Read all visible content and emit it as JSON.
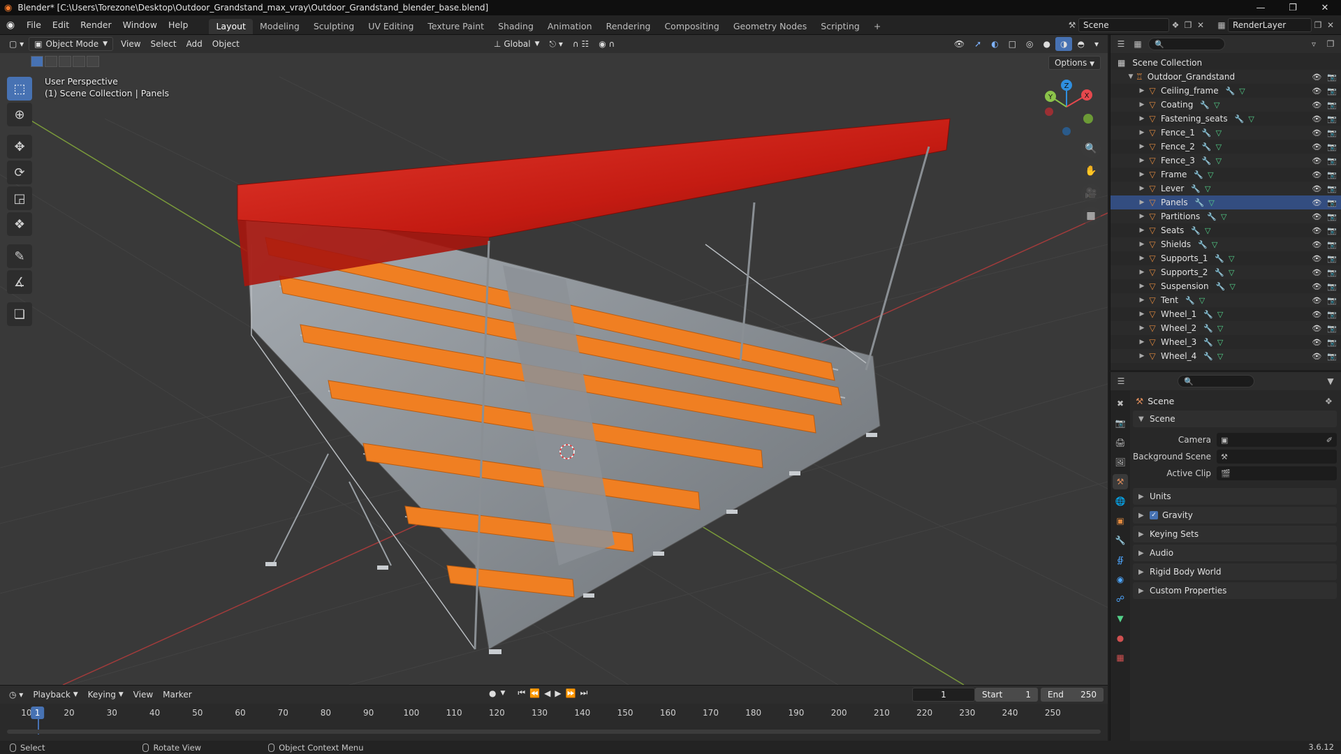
{
  "window": {
    "title": "Blender* [C:\\Users\\Torezone\\Desktop\\Outdoor_Grandstand_max_vray\\Outdoor_Grandstand_blender_base.blend]",
    "minimize": "—",
    "maximize": "❐",
    "close": "✕"
  },
  "menu": [
    "File",
    "Edit",
    "Render",
    "Window",
    "Help"
  ],
  "workspaces": [
    "Layout",
    "Modeling",
    "Sculpting",
    "UV Editing",
    "Texture Paint",
    "Shading",
    "Animation",
    "Rendering",
    "Compositing",
    "Geometry Nodes",
    "Scripting"
  ],
  "workspace_add": "+",
  "scene_name": "Scene",
  "render_layer": "RenderLayer",
  "viewport": {
    "mode": "Object Mode",
    "menus": [
      "View",
      "Select",
      "Add",
      "Object"
    ],
    "orientation": "Global",
    "options": "Options",
    "perspective": "User Perspective",
    "context": "(1) Scene Collection | Panels",
    "gizmo_axes": {
      "x": "X",
      "y": "Y",
      "z": "Z"
    }
  },
  "outliner": {
    "root": "Scene Collection",
    "collection": "Outdoor_Grandstand",
    "objects": [
      "Ceiling_frame",
      "Coating",
      "Fastening_seats",
      "Fence_1",
      "Fence_2",
      "Fence_3",
      "Frame",
      "Lever",
      "Panels",
      "Partitions",
      "Seats",
      "Shields",
      "Supports_1",
      "Supports_2",
      "Suspension",
      "Tent",
      "Wheel_1",
      "Wheel_2",
      "Wheel_3",
      "Wheel_4"
    ],
    "selected": "Panels"
  },
  "properties": {
    "breadcrumb": "Scene",
    "panel_title": "Scene",
    "camera_label": "Camera",
    "background_scene_label": "Background Scene",
    "active_clip_label": "Active Clip",
    "sections": [
      "Units",
      "Gravity",
      "Keying Sets",
      "Audio",
      "Rigid Body World",
      "Custom Properties"
    ],
    "gravity_checked": true
  },
  "timeline": {
    "menus": [
      "Playback",
      "Keying",
      "View",
      "Marker"
    ],
    "current_frame": "1",
    "start_label": "Start",
    "start_value": "1",
    "end_label": "End",
    "end_value": "250",
    "ticks": [
      "1",
      "10",
      "20",
      "30",
      "40",
      "50",
      "60",
      "70",
      "80",
      "90",
      "100",
      "110",
      "120",
      "130",
      "140",
      "150",
      "160",
      "170",
      "180",
      "190",
      "200",
      "210",
      "220",
      "230",
      "240",
      "250"
    ]
  },
  "status": {
    "select": "Select",
    "rotate": "Rotate View",
    "context_menu": "Object Context Menu",
    "version": "3.6.12"
  },
  "colors": {
    "accent": "#4772b3",
    "roof": "#c41b12",
    "seat": "#f07f22",
    "metal": "#8f9499",
    "axis_x": "#e5484d",
    "axis_y": "#8bc34a",
    "axis_z": "#2f8fe0"
  }
}
